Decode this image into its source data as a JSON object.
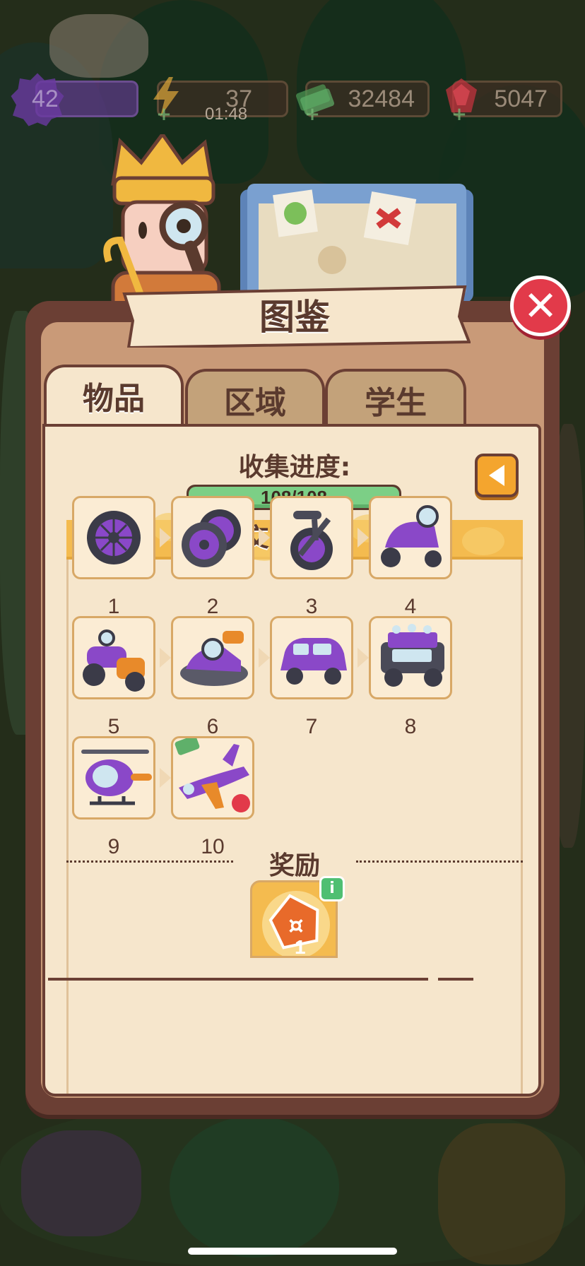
{
  "hud": {
    "level": "42",
    "energy": "37",
    "energy_timer": "01:48",
    "cash": "32484",
    "gems": "5047"
  },
  "panel": {
    "title": "图鉴",
    "tabs": [
      {
        "label": "物品",
        "active": true
      },
      {
        "label": "区域",
        "active": false
      },
      {
        "label": "学生",
        "active": false
      }
    ],
    "progress_label": "收集进度:",
    "progress_text": "108/108",
    "progress_fraction": 1.0,
    "category": "交通工具",
    "items": [
      {
        "num": "1",
        "icon": "wheel-icon"
      },
      {
        "num": "2",
        "icon": "two-wheels-icon"
      },
      {
        "num": "3",
        "icon": "scooter-icon"
      },
      {
        "num": "4",
        "icon": "moped-icon"
      },
      {
        "num": "5",
        "icon": "sidecar-motorcycle-icon"
      },
      {
        "num": "6",
        "icon": "jet-ski-icon"
      },
      {
        "num": "7",
        "icon": "car-icon"
      },
      {
        "num": "8",
        "icon": "jeep-icon"
      },
      {
        "num": "9",
        "icon": "helicopter-icon"
      },
      {
        "num": "10",
        "icon": "airplane-icon"
      }
    ],
    "reward_label": "奖励",
    "reward_count": "1"
  },
  "colors": {
    "panel_border": "#6b3f34",
    "panel_bg": "#f6e6cc",
    "accent_orange": "#f4a52e",
    "progress_green": "#7ccf86",
    "vehicle_purple": "#8a48c8",
    "close_red": "#e23a4a"
  }
}
